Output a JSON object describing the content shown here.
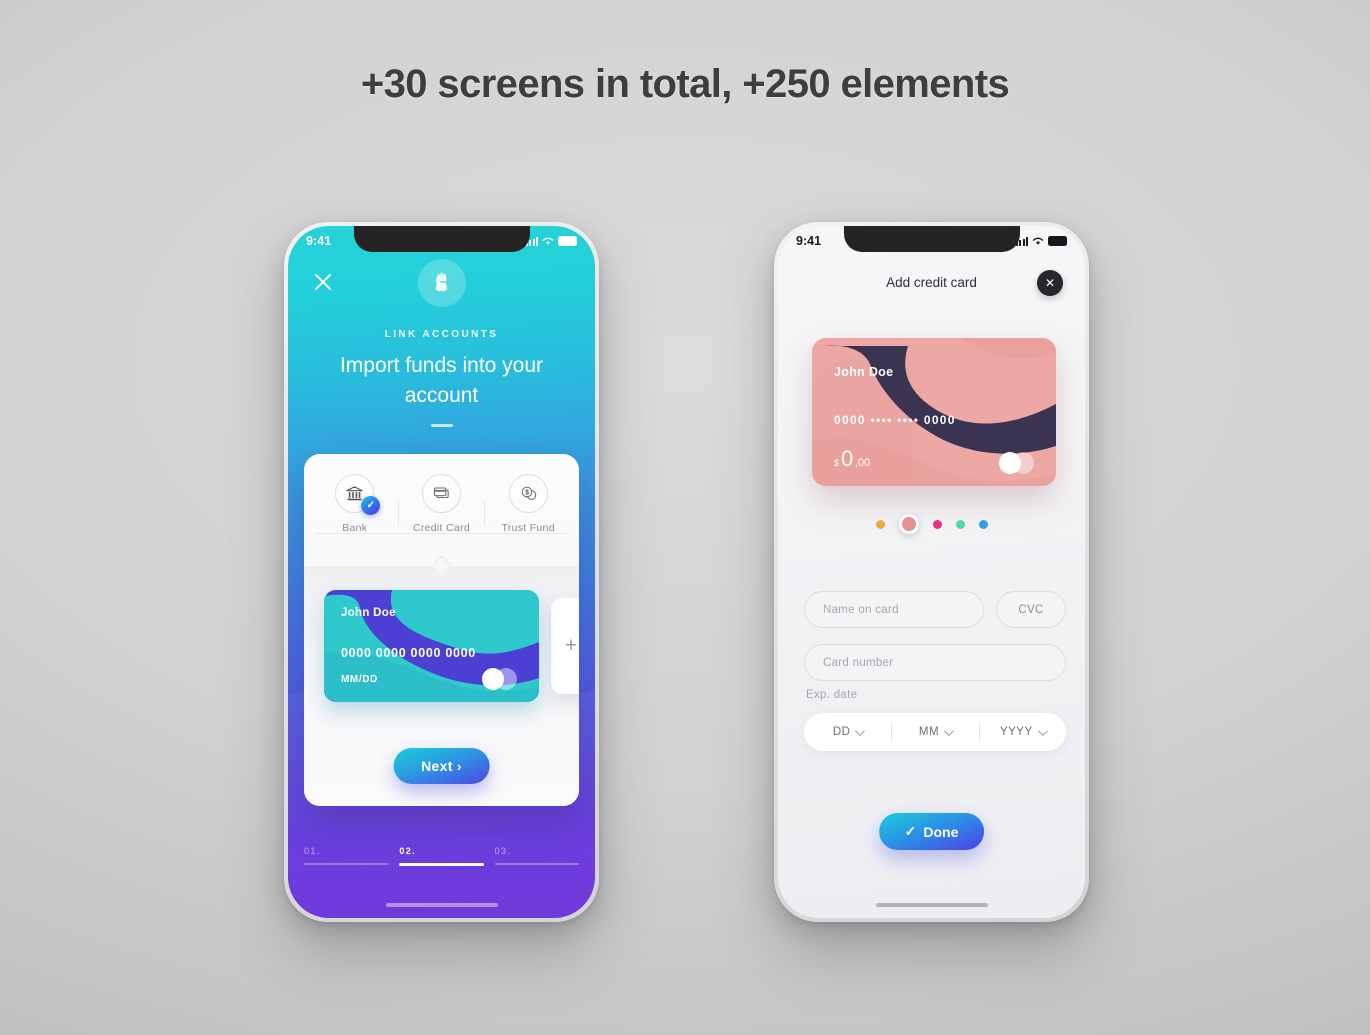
{
  "headline": "+30 screens in total, +250 elements",
  "left_phone": {
    "status": {
      "time": "9:41",
      "signal_icon": "signal-bars-icon",
      "wifi_icon": "wifi-icon",
      "battery_icon": "battery-icon"
    },
    "close_icon": "close-icon",
    "logo_icon": "brand-logo-icon",
    "eyebrow": "LINK ACCOUNTS",
    "title": "Import funds into your account",
    "methods": [
      {
        "label": "Bank",
        "icon": "bank-icon",
        "selected": true,
        "badge_icon": "check-icon"
      },
      {
        "label": "Credit Card",
        "icon": "credit-card-icon",
        "selected": false
      },
      {
        "label": "Trust Fund",
        "icon": "coins-icon",
        "selected": false
      }
    ],
    "card": {
      "name": "John Doe",
      "number": "0000 0000 0000 0000",
      "expiry": "MM/DD",
      "logo_icon": "mastercard-circles-icon"
    },
    "add_card_icon": "plus-icon",
    "next_label": "Next",
    "next_chevron": "›",
    "steps": [
      {
        "num": "01.",
        "active": false
      },
      {
        "num": "02.",
        "active": true
      },
      {
        "num": "03.",
        "active": false
      }
    ]
  },
  "right_phone": {
    "status": {
      "time": "9:41",
      "signal_icon": "signal-bars-icon",
      "wifi_icon": "wifi-icon",
      "battery_icon": "battery-icon"
    },
    "title": "Add credit card",
    "close_icon": "close-icon",
    "close_glyph": "✕",
    "card": {
      "name": "John Doe",
      "number_prefix": "0000",
      "number_mask": "••••  ••••",
      "number_suffix": "0000",
      "currency": "$",
      "amount": "0",
      "decimals": ",00",
      "logo_icon": "mastercard-circles-icon"
    },
    "color_dots": [
      {
        "color": "#efa845",
        "selected": false
      },
      {
        "color": "#e4918f",
        "selected": true
      },
      {
        "color": "#ec2f7e",
        "selected": false
      },
      {
        "color": "#4fd9a4",
        "selected": false
      },
      {
        "color": "#3b9ae0",
        "selected": false
      }
    ],
    "fields": {
      "name_placeholder": "Name on card",
      "cvc_placeholder": "CVC",
      "number_placeholder": "Card number"
    },
    "exp_label": "Exp. date",
    "exp_selects": [
      {
        "value": "DD",
        "icon": "chevron-down-icon"
      },
      {
        "value": "MM",
        "icon": "chevron-down-icon"
      },
      {
        "value": "YYYY",
        "icon": "chevron-down-icon"
      }
    ],
    "done_label": "Done",
    "done_icon": "check-icon"
  }
}
